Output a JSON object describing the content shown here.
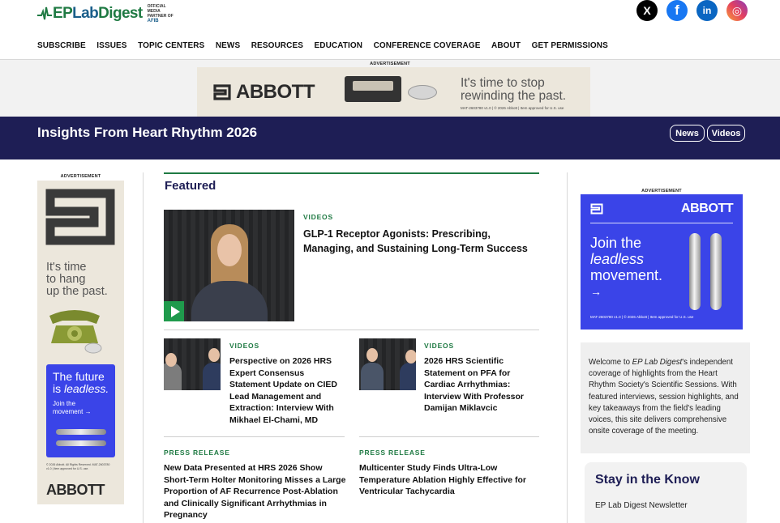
{
  "header": {
    "logo_text_ep": "EP",
    "logo_text_lab": "Lab",
    "logo_text_digest": "Digest",
    "logo_partner_line1": "OFFICIAL MEDIA",
    "logo_partner_line2": "PARTNER OF",
    "logo_partner_org": "AFIB"
  },
  "social": [
    {
      "name": "x",
      "glyph": "X",
      "color": "#000000"
    },
    {
      "name": "facebook",
      "glyph": "f",
      "color": "#1877f2"
    },
    {
      "name": "linkedin",
      "glyph": "in",
      "color": "#0a66c2"
    },
    {
      "name": "instagram",
      "glyph": "◎",
      "color": "#e4405f"
    }
  ],
  "nav": [
    "SUBSCRIBE",
    "ISSUES",
    "TOPIC CENTERS",
    "NEWS",
    "RESOURCES",
    "EDUCATION",
    "CONFERENCE COVERAGE",
    "ABOUT",
    "GET PERMISSIONS"
  ],
  "ads": {
    "label": "ADVERTISEMENT",
    "brand": "ABBOTT",
    "top_tagline_1": "It's time to stop",
    "top_tagline_2": "rewinding the past.",
    "top_fine": "MAT-2603780 v1.0 | © 2026 Abbott | Item approved for U.S. use",
    "left_tagline_1": "It's time",
    "left_tagline_2": "to hang",
    "left_tagline_3": "up the past.",
    "left_blue_1": "The future",
    "left_blue_2": "is ",
    "left_blue_2b": "leadless.",
    "left_blue_3": "Join the",
    "left_blue_4": "movement →",
    "left_fine": "© 2026 Abbott. All Rights Reserved. MAT-2603780 v1.0 | Item approved for U.S. use.",
    "right_tagline_1": "Join the",
    "right_tagline_2": "leadless",
    "right_tagline_3": "movement.",
    "right_arrow": "→",
    "right_fine": "MAT-2603780 v1.0 | © 2026 Abbott | Item approved for U.S. use"
  },
  "banner": {
    "title": "Insights From Heart Rhythm 2026",
    "pills": [
      "News",
      "Videos"
    ]
  },
  "featured": {
    "heading": "Featured",
    "main": {
      "category": "VIDEOS",
      "headline": "GLP-1 Receptor Agonists: Prescribing, Managing, and Sustaining Long-Term Success"
    },
    "cards": [
      {
        "category": "VIDEOS",
        "headline": "Perspective on 2026 HRS Expert Consensus Statement Update on CIED Lead Management and Extraction: Interview With Mikhael El-Chami, MD"
      },
      {
        "category": "VIDEOS",
        "headline": "2026 HRS Scientific Statement on PFA for Cardiac Arrhythmias: Interview With Professor Damijan Miklavcic"
      }
    ],
    "press": [
      {
        "category": "PRESS RELEASE",
        "headline": "New Data Presented at HRS 2026 Show Short-Term Holter Monitoring Misses a Large Proportion of AF Recurrence Post-Ablation and Clinically Significant Arrhythmias in Pregnancy"
      },
      {
        "category": "PRESS RELEASE",
        "headline": "Multicenter Study Finds Ultra-Low Temperature Ablation Highly Effective for Ventricular Tachycardia"
      }
    ]
  },
  "welcome": {
    "prefix": "Welcome to ",
    "brand": "EP Lab Digest",
    "text": "'s independent coverage of highlights from the Heart Rhythm Society's Scientific Sessions. With featured interviews, session highlights, and key takeaways from the field's leading voices, this site delivers comprehensive onsite coverage of the meeting."
  },
  "stay": {
    "title": "Stay in the Know",
    "subtitle": "EP Lab Digest Newsletter"
  }
}
